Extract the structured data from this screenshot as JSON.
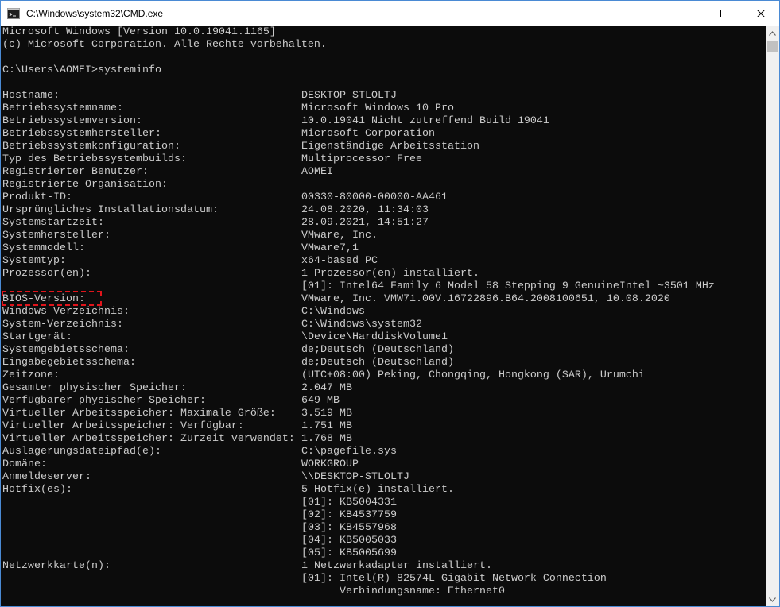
{
  "window": {
    "title": "C:\\Windows\\system32\\CMD.exe",
    "icon": "cmd-icon",
    "accent_border": "#4a8ad4",
    "console_background": "#0c0c0c",
    "console_text": "#cccccc",
    "highlight_color": "#e0141b"
  },
  "header_lines": [
    "Microsoft Windows [Version 10.0.19041.1165]",
    "(c) Microsoft Corporation. Alle Rechte vorbehalten.",
    "",
    "C:\\Users\\AOMEI>systeminfo",
    ""
  ],
  "info_rows": [
    {
      "key": "Hostname:",
      "value": "DESKTOP-STLOLTJ"
    },
    {
      "key": "Betriebssystemname:",
      "value": "Microsoft Windows 10 Pro"
    },
    {
      "key": "Betriebssystemversion:",
      "value": "10.0.19041 Nicht zutreffend Build 19041"
    },
    {
      "key": "Betriebssystemhersteller:",
      "value": "Microsoft Corporation"
    },
    {
      "key": "Betriebssystemkonfiguration:",
      "value": "Eigenständige Arbeitsstation"
    },
    {
      "key": "Typ des Betriebssystembuilds:",
      "value": "Multiprocessor Free"
    },
    {
      "key": "Registrierter Benutzer:",
      "value": "AOMEI"
    },
    {
      "key": "Registrierte Organisation:",
      "value": ""
    },
    {
      "key": "Produkt-ID:",
      "value": "00330-80000-00000-AA461"
    },
    {
      "key": "Ursprüngliches Installationsdatum:",
      "value": "24.08.2020, 11:34:03"
    },
    {
      "key": "Systemstartzeit:",
      "value": "28.09.2021, 14:51:27"
    },
    {
      "key": "Systemhersteller:",
      "value": "VMware, Inc."
    },
    {
      "key": "Systemmodell:",
      "value": "VMware7,1"
    },
    {
      "key": "Systemtyp:",
      "value": "x64-based PC"
    },
    {
      "key": "Prozessor(en):",
      "value": "1 Prozessor(en) installiert."
    },
    {
      "key": "",
      "value": "[01]: Intel64 Family 6 Model 58 Stepping 9 GenuineIntel ~3501 MHz"
    },
    {
      "key": "BIOS-Version:",
      "value": "VMware, Inc. VMW71.00V.16722896.B64.2008100651, 10.08.2020",
      "highlighted": true
    },
    {
      "key": "Windows-Verzeichnis:",
      "value": "C:\\Windows"
    },
    {
      "key": "System-Verzeichnis:",
      "value": "C:\\Windows\\system32"
    },
    {
      "key": "Startgerät:",
      "value": "\\Device\\HarddiskVolume1"
    },
    {
      "key": "Systemgebietsschema:",
      "value": "de;Deutsch (Deutschland)"
    },
    {
      "key": "Eingabegebietsschema:",
      "value": "de;Deutsch (Deutschland)"
    },
    {
      "key": "Zeitzone:",
      "value": "(UTC+08:00) Peking, Chongqing, Hongkong (SAR), Urumchi"
    },
    {
      "key": "Gesamter physischer Speicher:",
      "value": "2.047 MB"
    },
    {
      "key": "Verfügbarer physischer Speicher:",
      "value": "649 MB"
    },
    {
      "key": "Virtueller Arbeitsspeicher: Maximale Größe:",
      "value": "3.519 MB"
    },
    {
      "key": "Virtueller Arbeitsspeicher: Verfügbar:",
      "value": "1.751 MB"
    },
    {
      "key": "Virtueller Arbeitsspeicher: Zurzeit verwendet:",
      "value": "1.768 MB"
    },
    {
      "key": "Auslagerungsdateipfad(e):",
      "value": "C:\\pagefile.sys"
    },
    {
      "key": "Domäne:",
      "value": "WORKGROUP"
    },
    {
      "key": "Anmeldeserver:",
      "value": "\\\\DESKTOP-STLOLTJ"
    },
    {
      "key": "Hotfix(es):",
      "value": "5 Hotfix(e) installiert."
    },
    {
      "key": "",
      "value": "[01]: KB5004331"
    },
    {
      "key": "",
      "value": "[02]: KB4537759"
    },
    {
      "key": "",
      "value": "[03]: KB4557968"
    },
    {
      "key": "",
      "value": "[04]: KB5005033"
    },
    {
      "key": "",
      "value": "[05]: KB5005699"
    },
    {
      "key": "Netzwerkkarte(n):",
      "value": "1 Netzwerkadapter installiert."
    },
    {
      "key": "",
      "value": "[01]: Intel(R) 82574L Gigabit Network Connection"
    },
    {
      "key": "",
      "value": "Verbindungsname: Ethernet0",
      "deep": true
    }
  ],
  "controls": {
    "minimize_icon": "minimize-icon",
    "maximize_icon": "maximize-icon",
    "close_icon": "close-icon"
  }
}
